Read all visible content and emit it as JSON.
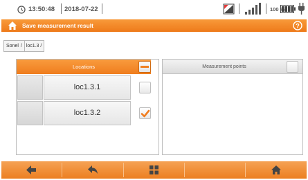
{
  "status_bar": {
    "time": "13:50:48",
    "date": "2018-07-22",
    "battery_percent": "100 %",
    "icons": [
      "clock-icon",
      "recorder-icon",
      "signal-icon",
      "battery-icon",
      "plug-icon"
    ]
  },
  "title_bar": {
    "title": "Save measurement result",
    "icons": [
      "home-icon",
      "help-icon"
    ]
  },
  "breadcrumb": {
    "root": "Sonel",
    "separator": "/",
    "current": "loc1.3 /"
  },
  "locations_panel": {
    "header": "Locations",
    "rows": [
      {
        "name": "loc1.3.1",
        "checked": false
      },
      {
        "name": "loc1.3.2",
        "checked": true
      }
    ]
  },
  "points_panel": {
    "header": "Measurement points"
  },
  "toolbar": {
    "buttons": [
      "arrow-left-icon",
      "back-icon",
      "grid-menu-icon",
      "empty",
      "home-icon"
    ]
  },
  "colors": {
    "accent": "#ef7d1e",
    "checkmark": "#f07d20",
    "panel_border": "#bdbdbd"
  }
}
